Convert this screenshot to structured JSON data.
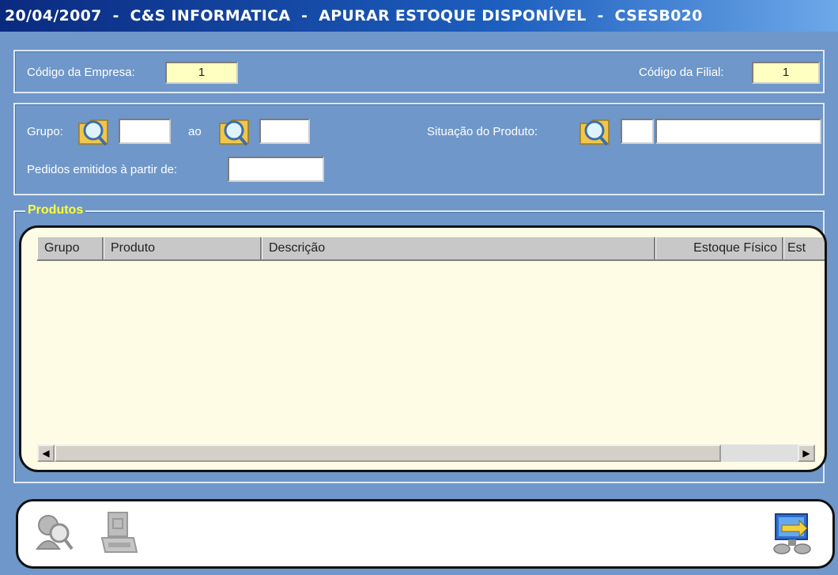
{
  "window": {
    "title": "20/04/2007  -  C&S INFORMATICA  -  APURAR ESTOQUE DISPONÍVEL  -  CSESB020"
  },
  "company": {
    "empresa_label": "Código da Empresa:",
    "empresa_value": "1",
    "filial_label": "Código da Filial:",
    "filial_value": "1"
  },
  "filters": {
    "grupo_label": "Grupo:",
    "grupo_from": "",
    "ao_label": "ao",
    "grupo_to": "",
    "situacao_label": "Situação do Produto:",
    "situacao_code": "",
    "situacao_desc": "",
    "pedidos_label": "Pedidos emitidos à partir de:",
    "pedidos_date": ""
  },
  "produtos": {
    "legend": "Produtos",
    "columns": [
      "Grupo",
      "Produto",
      "Descrição",
      "Estoque Físico",
      "Est"
    ],
    "rows": []
  },
  "toolbar": {
    "icons": [
      "search-person-icon",
      "print-icon",
      "exit-icon"
    ]
  }
}
